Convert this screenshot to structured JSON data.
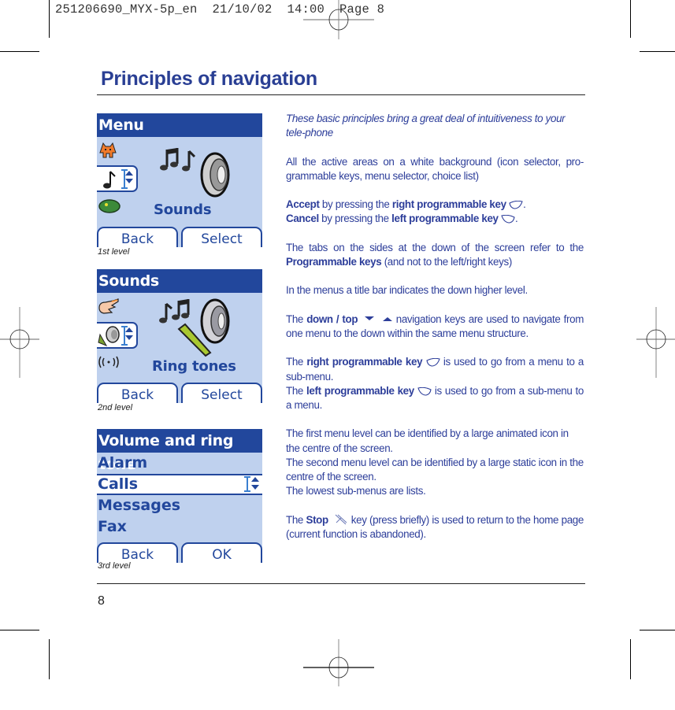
{
  "slug": {
    "text": "251206690_MYX-5p_en  21/10/02  14:00  Page 8"
  },
  "page": {
    "title": "Principles of navigation",
    "number": "8"
  },
  "colors": {
    "accent_blue": "#22479c",
    "title_blue": "#2a3f94",
    "screen_bg": "#bfd1ee",
    "text_blue": "#2d3e9a"
  },
  "screens": [
    {
      "level_caption": "1st level",
      "title": "Menu",
      "label": "Sounds",
      "side_icons": [
        "monster-icon",
        "music-note-icon",
        "chameleon-icon"
      ],
      "main_icon": "music-notes-speaker-icon",
      "softkey_left": "Back",
      "softkey_right": "Select"
    },
    {
      "level_caption": "2nd level",
      "title": "Sounds",
      "label": "Ring tones",
      "side_icons": [
        "pointing-hand-icon",
        "speaker-volume-icon",
        "vibrate-icon"
      ],
      "main_icon": "ring-tones-icon",
      "softkey_left": "Back",
      "softkey_right": "Select"
    },
    {
      "level_caption": "3rd level",
      "title": "Volume and ring tone",
      "items": [
        "Alarm",
        "Calls",
        "Messages",
        "Fax"
      ],
      "selected_item": "Calls",
      "softkey_left": "Back",
      "softkey_right": "OK"
    }
  ],
  "text": {
    "intro": "These basic principles bring a great deal of intuitiveness to your tele-phone",
    "active_areas": "All the active areas on a white background (icon selector, pro-grammable keys, menu selector, choice list)",
    "accept_bold": "Accept",
    "accept_mid": " by pressing the ",
    "accept_key": "right programmable key",
    "cancel_bold": "Cancel",
    "cancel_mid": " by pressing the ",
    "cancel_key": "left programmable key",
    "tabs_text": "The tabs on the sides at the down of the screen refer to the ",
    "tabs_bold": "Programmable keys",
    "tabs_tail": " (and not to the left/right keys)",
    "titlebar_text": "In the menus a title bar indicates the down higher level.",
    "nav_pre": "The ",
    "nav_bold": "down / top",
    "nav_tail": " navigation keys are used to navigate from one menu to the down within the same menu structure.",
    "right_pre": "The ",
    "right_bold": "right programmable key",
    "right_tail": " is used to go from a menu to a sub-menu.",
    "left_pre": "The ",
    "left_bold": "left programmable key",
    "left_tail": " is used to go from a sub-menu to a menu.",
    "levels_1": "The first menu level can be identified by a large animated icon in the centre of the screen.",
    "levels_2": "The second menu level can be identified by a large static icon in the centre of the screen.",
    "levels_3": "The lowest sub-menus are lists.",
    "stop_pre": "The ",
    "stop_bold": "Stop",
    "stop_tail": " key (press briefly) is used to return to the home page (current function is abandoned)."
  }
}
